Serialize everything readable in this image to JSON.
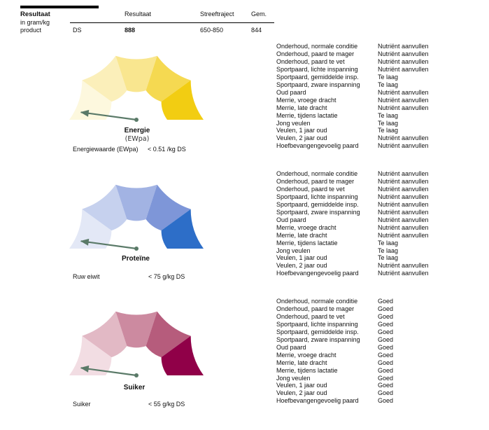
{
  "header": {
    "title": "Resultaat",
    "subtitle": "in gram/kg product",
    "columns": {
      "resultaat": "Resultaat",
      "streeftraject": "Streeftraject",
      "gem": "Gem."
    },
    "ds_row": {
      "label": "DS",
      "value": "888",
      "range": "650-850",
      "avg": "844"
    }
  },
  "gauges": [
    {
      "title": "Energie",
      "subtitle": "(EWpa)",
      "measure_label": "Energiewaarde (EWpa)",
      "measure_value": "< 0.51 /kg DS",
      "level": 0.1,
      "colors": [
        "#fdf8de",
        "#fbefba",
        "#f9e68f",
        "#f5d951",
        "#f2cd12"
      ]
    },
    {
      "title": "Proteïne",
      "subtitle": "",
      "measure_label": "Ruw eiwit",
      "measure_value": "< 75 g/kg DS",
      "level": 0.1,
      "colors": [
        "#e3e8f6",
        "#c6d1ee",
        "#a2b3e3",
        "#7e96d8",
        "#2d6ec8"
      ]
    },
    {
      "title": "Suiker",
      "subtitle": "",
      "measure_label": "Suiker",
      "measure_value": "< 55 g/kg DS",
      "level": 0.1,
      "colors": [
        "#f2dde3",
        "#e2b9c5",
        "#cc8aa0",
        "#b65c7c",
        "#900048"
      ]
    }
  ],
  "lists": [
    [
      [
        "Onderhoud, normale conditie",
        "Nutriënt aanvullen"
      ],
      [
        "Onderhoud, paard te mager",
        "Nutriënt aanvullen"
      ],
      [
        "Onderhoud, paard te vet",
        "Nutriënt aanvullen"
      ],
      [
        "Sportpaard, lichte inspanning",
        "Nutriënt aanvullen"
      ],
      [
        "Sportpaard, gemiddelde insp.",
        "Te laag"
      ],
      [
        "Sportpaard, zware inspanning",
        "Te laag"
      ],
      [
        "Oud paard",
        "Nutriënt aanvullen"
      ],
      [
        "Merrie, vroege dracht",
        "Nutriënt aanvullen"
      ],
      [
        "Merrie, late dracht",
        "Nutriënt aanvullen"
      ],
      [
        "Merrie, tijdens lactatie",
        "Te laag"
      ],
      [
        "Jong veulen",
        "Te laag"
      ],
      [
        "Veulen, 1 jaar oud",
        "Te laag"
      ],
      [
        "Veulen, 2 jaar oud",
        "Nutriënt aanvullen"
      ],
      [
        "Hoefbevangengevoelig paard",
        "Nutriënt aanvullen"
      ]
    ],
    [
      [
        "Onderhoud, normale conditie",
        "Nutriënt aanvullen"
      ],
      [
        "Onderhoud, paard te mager",
        "Nutriënt aanvullen"
      ],
      [
        "Onderhoud, paard te vet",
        "Nutriënt aanvullen"
      ],
      [
        "Sportpaard, lichte inspanning",
        "Nutriënt aanvullen"
      ],
      [
        "Sportpaard, gemiddelde insp.",
        "Nutriënt aanvullen"
      ],
      [
        "Sportpaard, zware inspanning",
        "Nutriënt aanvullen"
      ],
      [
        "Oud paard",
        "Nutriënt aanvullen"
      ],
      [
        "Merrie, vroege dracht",
        "Nutriënt aanvullen"
      ],
      [
        "Merrie, late dracht",
        "Nutriënt aanvullen"
      ],
      [
        "Merrie, tijdens lactatie",
        "Te laag"
      ],
      [
        "Jong veulen",
        "Te laag"
      ],
      [
        "Veulen, 1 jaar oud",
        "Te laag"
      ],
      [
        "Veulen, 2 jaar oud",
        "Nutriënt aanvullen"
      ],
      [
        "Hoefbevangengevoelig paard",
        "Nutriënt aanvullen"
      ]
    ],
    [
      [
        "Onderhoud, normale conditie",
        "Goed"
      ],
      [
        "Onderhoud, paard te mager",
        "Goed"
      ],
      [
        "Onderhoud, paard te vet",
        "Goed"
      ],
      [
        "Sportpaard, lichte inspanning",
        "Goed"
      ],
      [
        "Sportpaard, gemiddelde insp.",
        "Goed"
      ],
      [
        "Sportpaard, zware inspanning",
        "Goed"
      ],
      [
        "Oud paard",
        "Goed"
      ],
      [
        "Merrie, vroege dracht",
        "Goed"
      ],
      [
        "Merrie, late dracht",
        "Goed"
      ],
      [
        "Merrie, tijdens lactatie",
        "Goed"
      ],
      [
        "Jong veulen",
        "Goed"
      ],
      [
        "Veulen, 1 jaar oud",
        "Goed"
      ],
      [
        "Veulen, 2 jaar oud",
        "Goed"
      ],
      [
        "Hoefbevangengevoelig paard",
        "Goed"
      ]
    ]
  ],
  "needle_color": "#5a7a68"
}
